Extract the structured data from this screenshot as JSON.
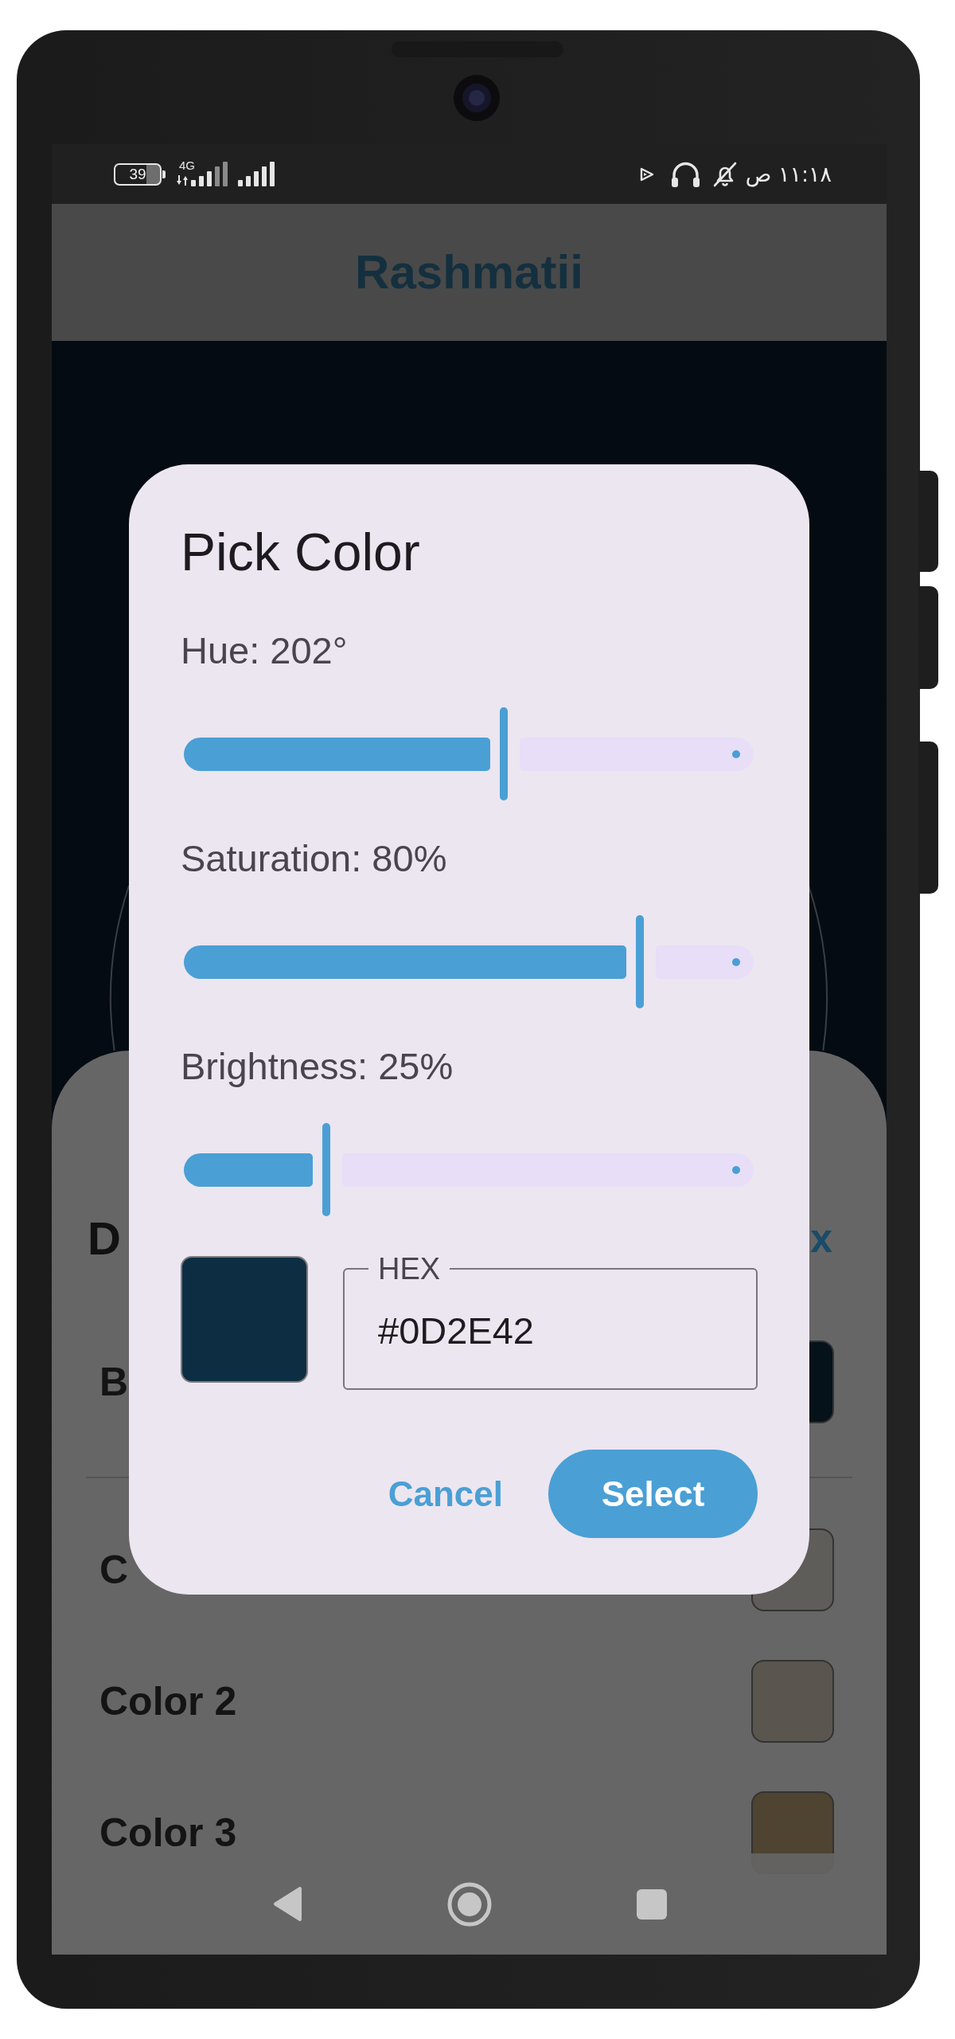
{
  "status_bar": {
    "battery": "39",
    "network_type": "4G",
    "time": "١١:١٨ ص"
  },
  "app_bar": {
    "title": "Rashmatii"
  },
  "sheet": {
    "title": "D",
    "action": "x",
    "background": {
      "label": "B",
      "color": "#06121a"
    },
    "colors": [
      {
        "label": "C",
        "color": "#5e5d59"
      },
      {
        "label": "Color 2",
        "color": "#5a554f"
      },
      {
        "label": "Color 3",
        "color": "#4e4431"
      }
    ]
  },
  "dialog": {
    "title": "Pick Color",
    "sliders": [
      {
        "label": "Hue: 202°",
        "level": 0.561
      },
      {
        "label": "Saturation: 80%",
        "level": 0.8
      },
      {
        "label": "Brightness: 25%",
        "level": 0.25
      }
    ],
    "hex_field": {
      "label": "HEX",
      "value": "#0D2E42"
    },
    "buttons": [
      {
        "kind": "text",
        "label": "Cancel"
      },
      {
        "kind": "filled",
        "label": "Select"
      }
    ]
  }
}
